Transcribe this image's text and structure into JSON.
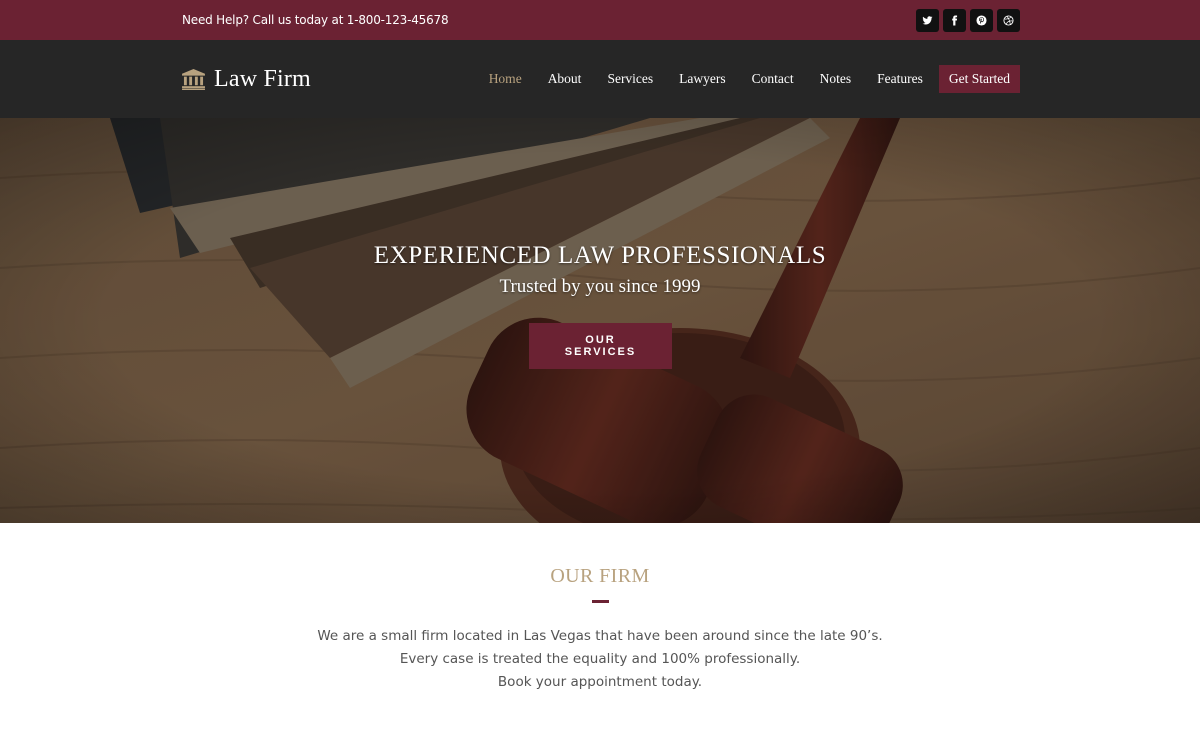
{
  "topbar": {
    "help_text": "Need Help? Call us today at 1-800-123-45678",
    "socials": [
      {
        "icon": "twitter-icon"
      },
      {
        "icon": "facebook-icon"
      },
      {
        "icon": "pinterest-icon"
      },
      {
        "icon": "dribbble-icon"
      }
    ]
  },
  "header": {
    "brand_icon": "courthouse-icon",
    "brand_name": "Law Firm",
    "nav": [
      {
        "label": "Home",
        "active": true
      },
      {
        "label": "About"
      },
      {
        "label": "Services"
      },
      {
        "label": "Lawyers"
      },
      {
        "label": "Contact"
      },
      {
        "label": "Notes"
      },
      {
        "label": "Features"
      }
    ],
    "cta_label": "Get Started"
  },
  "hero": {
    "title": "EXPERIENCED LAW PROFESSIONALS",
    "subtitle": "Trusted by you since 1999",
    "button_label": "OUR SERVICES"
  },
  "firm": {
    "heading": "OUR FIRM",
    "lines": [
      "We are a small firm located in Las Vegas that have been around since the late 90’s.",
      "Every case is treated the equality and 100% professionally.",
      "Book your appointment today."
    ]
  },
  "colors": {
    "accent": "#6b2233",
    "gold": "#b8a27f",
    "header_bg": "#262626"
  }
}
